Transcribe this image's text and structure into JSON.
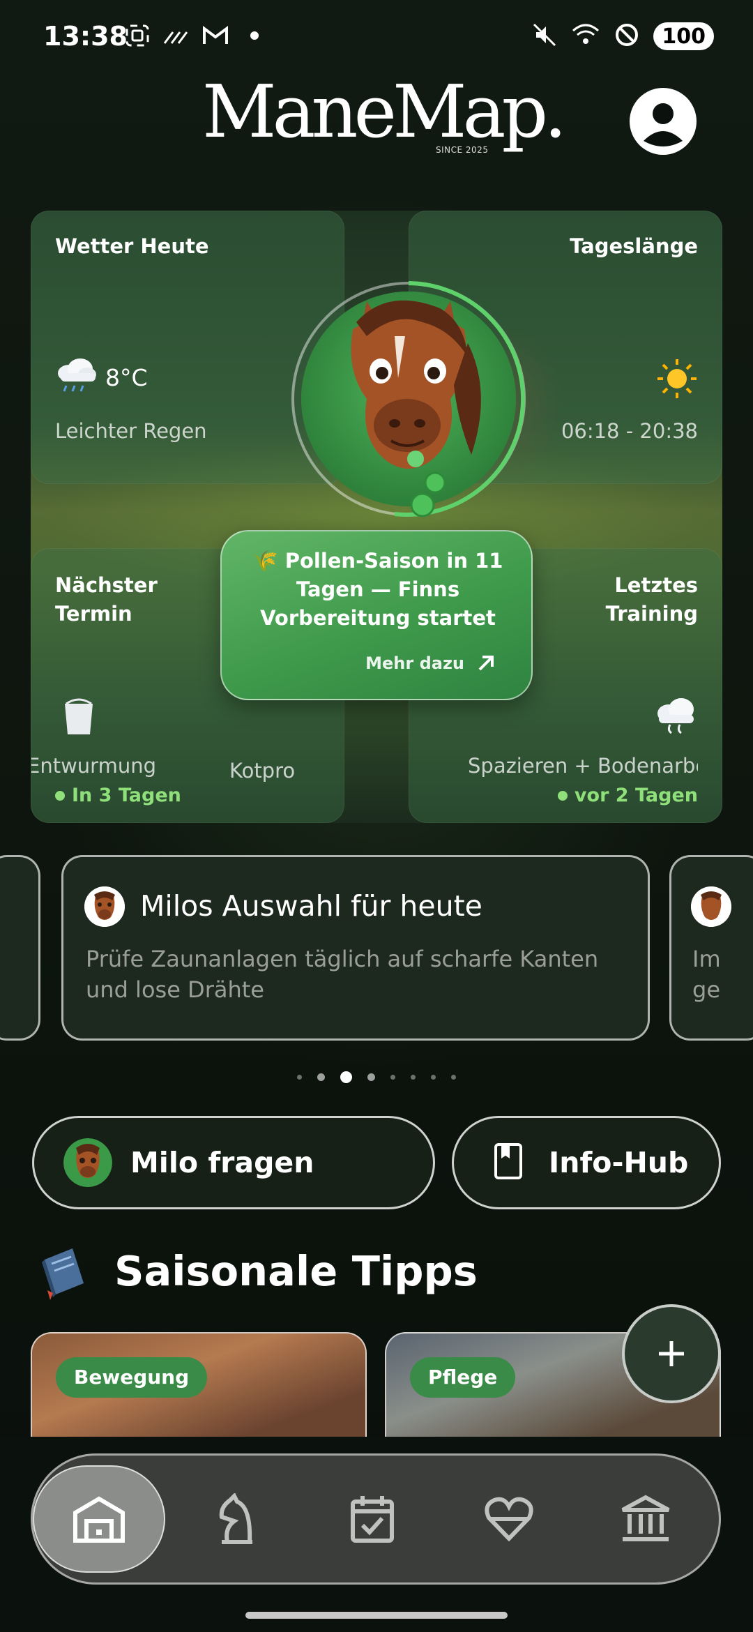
{
  "status_bar": {
    "time": "13:38",
    "battery": "100"
  },
  "header": {
    "logo": "ManeMap.",
    "logo_tagline": "SINCE 2025"
  },
  "dashboard": {
    "weather": {
      "title": "Wetter Heute",
      "temp": "8°C",
      "desc": "Leichter Regen",
      "icon": "rain-cloud-icon"
    },
    "daylength": {
      "title": "Tageslänge",
      "time": "06:18 - 20:38",
      "icon": "sun-icon"
    },
    "next_appointment": {
      "title_line1": "Nächster",
      "title_line2": "Termin",
      "item": "Entwurmung",
      "item2": "Kotpro",
      "status": "In 3 Tagen"
    },
    "last_training": {
      "title_line1": "Letztes",
      "title_line2": "Training",
      "item": "Spazieren + Bodenarbe",
      "status": "vor 2 Tagen"
    },
    "callout": {
      "text": "🌾 Pollen-Saison in 11 Tagen — Finns Vorbereitung startet",
      "link": "Mehr dazu"
    }
  },
  "carousel": {
    "main": {
      "title": "Milos Auswahl für heute",
      "body": "Prüfe Zaunanlagen täglich auf scharfe Kanten und lose Drähte"
    },
    "next_preview": {
      "line1": "Im",
      "line2": "ge"
    },
    "page_count": 8,
    "active_index": 2
  },
  "actions": {
    "milo": "Milo fragen",
    "info": "Info-Hub"
  },
  "section": {
    "title": "Saisonale Tipps",
    "tips": [
      {
        "badge": "Bewegung"
      },
      {
        "badge": "Pflege"
      }
    ]
  },
  "nav": {
    "items": [
      "home",
      "horse",
      "calendar",
      "health",
      "institution"
    ],
    "active": "home"
  },
  "colors": {
    "accent": "#3f9a4b",
    "status_green": "#8fe07a",
    "background": "#0b110c"
  }
}
